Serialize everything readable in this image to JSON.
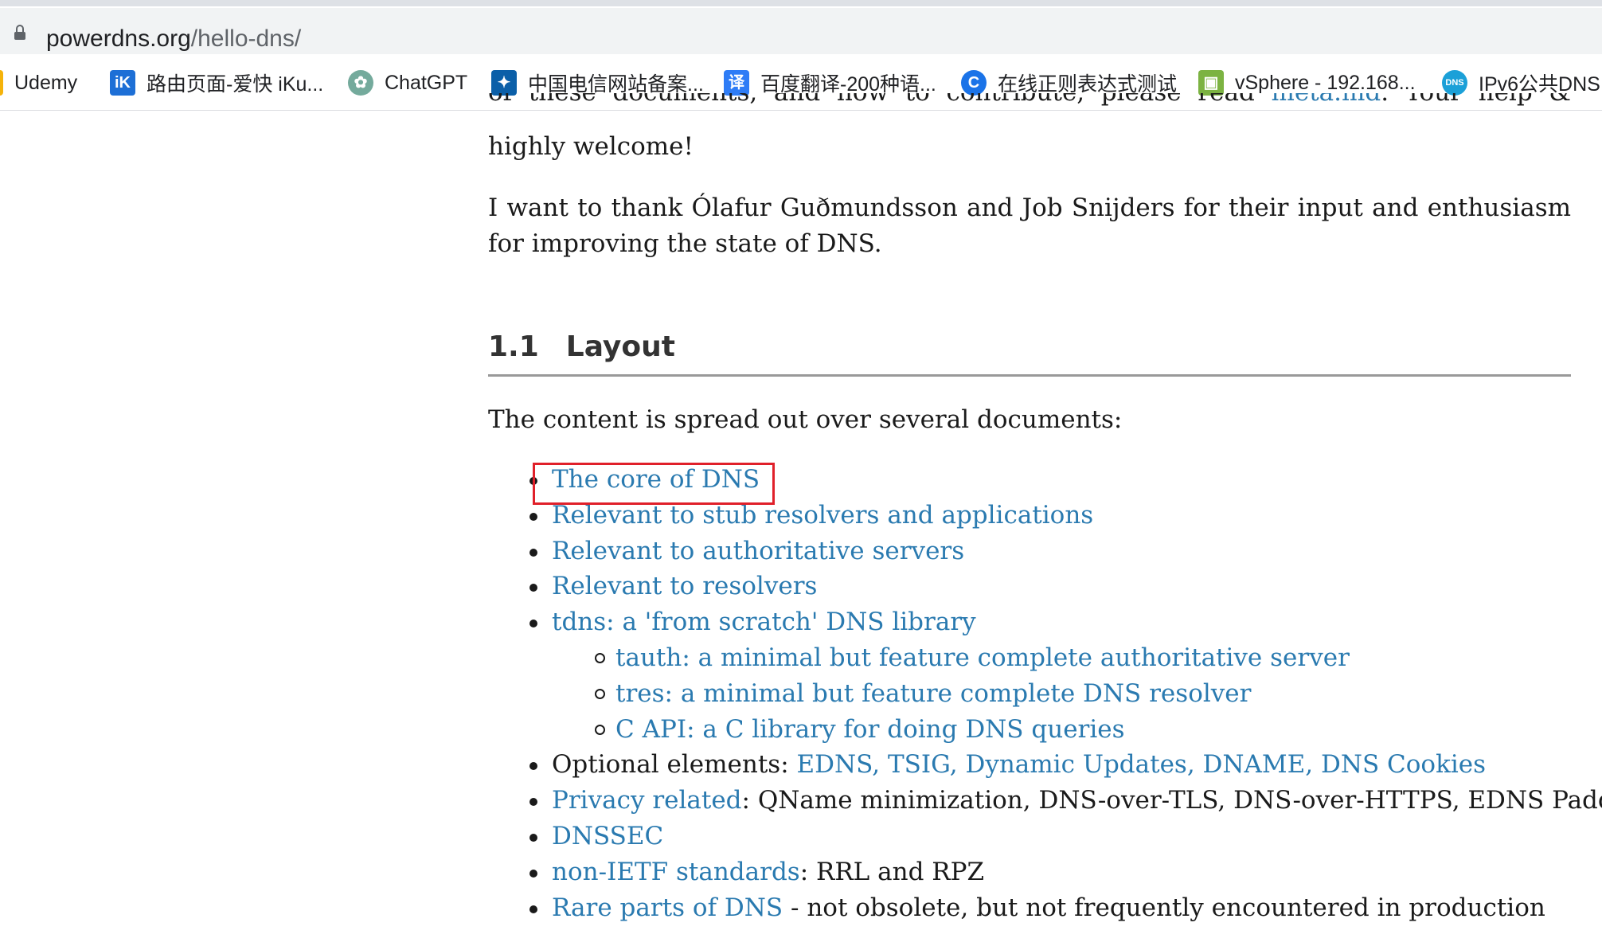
{
  "browser": {
    "url_host": "powerdns.org",
    "url_path": "/hello-dns/",
    "bookmarks": [
      {
        "label": "Udemy",
        "icon": "udemy-icon"
      },
      {
        "label": "路由页面-爱快 iKu...",
        "icon": "ikuai-icon",
        "glyph": "iK",
        "color": "#1d6fd6"
      },
      {
        "label": "ChatGPT",
        "icon": "chatgpt-icon",
        "glyph": "✿",
        "color": "#74aa9c"
      },
      {
        "label": "中国电信网站备案...",
        "icon": "china-telecom-icon",
        "glyph": "✦",
        "color": "#0b5fa8"
      },
      {
        "label": "百度翻译-200种语...",
        "icon": "baidu-translate-icon",
        "glyph": "译",
        "color": "#2e7cf6"
      },
      {
        "label": "在线正则表达式测试",
        "icon": "regex-tool-icon",
        "glyph": "C",
        "color": "#1a73e8"
      },
      {
        "label": "vSphere - 192.168...",
        "icon": "vsphere-icon",
        "glyph": "▣",
        "color": "#7cb342"
      },
      {
        "label": "IPv6公共DNS",
        "icon": "ipv6-dns-icon",
        "glyph": "DNS",
        "color": "#1ba0d8"
      }
    ]
  },
  "content": {
    "partial_line_before": "of these documents, and how to contribute, please read ",
    "meta_link": "meta.md",
    "partial_line_after": ". Your help & insights are",
    "help_tail": "highly welcome!",
    "thanks_para": "I want to thank Ólafur Guðmundsson and Job Snijders for their input and enthusiasm for improving the state of DNS.",
    "section_number": "1.1",
    "section_title": "Layout",
    "intro": "The content is spread out over several documents:",
    "items": [
      {
        "link": "The core of DNS",
        "rest": ""
      },
      {
        "link": "Relevant to stub resolvers and applications",
        "rest": ""
      },
      {
        "link": "Relevant to authoritative servers",
        "rest": ""
      },
      {
        "link": "Relevant to resolvers",
        "rest": ""
      },
      {
        "link": "tdns: a 'from scratch' DNS library",
        "rest": ""
      },
      {
        "link": "tauth: a minimal but feature complete authoritative server",
        "rest": "",
        "sub": true
      },
      {
        "link": "tres: a minimal but feature complete DNS resolver",
        "rest": "",
        "sub": true
      },
      {
        "link": "C API: a C library for doing DNS queries",
        "rest": "",
        "sub": true
      },
      {
        "prefix": "Optional elements: ",
        "link": "EDNS, TSIG, Dynamic Updates, DNAME, DNS Cookies",
        "rest": ""
      },
      {
        "link": "Privacy related",
        "rest": ": QName minimization, DNS-over-TLS, DNS-over-HTTPS, EDNS Padding"
      },
      {
        "link": "DNSSEC",
        "rest": ""
      },
      {
        "link": "non-IETF standards",
        "rest": ": RRL and RPZ"
      },
      {
        "link": "Rare parts of DNS",
        "rest": " - not obsolete, but not frequently encountered in production"
      }
    ]
  },
  "colors": {
    "link": "#2a7ab0",
    "highlight": "#e0202a"
  }
}
